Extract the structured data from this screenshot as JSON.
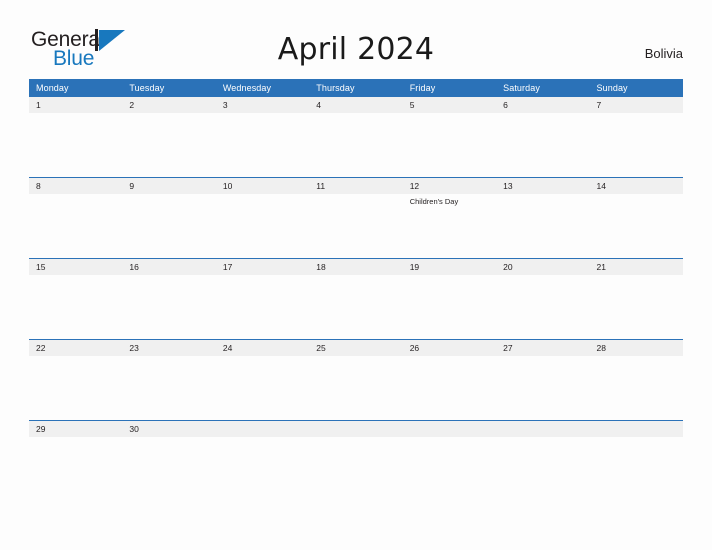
{
  "brand": {
    "name_part1": "General",
    "name_part2": "Blue",
    "mark": "triangle-flag-icon"
  },
  "header": {
    "title": "April 2024",
    "locale": "Bolivia"
  },
  "colors": {
    "header_blue": "#2b72b8",
    "brand_blue": "#1878be",
    "date_band_gray": "#f0f0f0",
    "page_background": "#fdfdfd",
    "text": "#231f20"
  },
  "calendar": {
    "day_names": [
      "Monday",
      "Tuesday",
      "Wednesday",
      "Thursday",
      "Friday",
      "Saturday",
      "Sunday"
    ],
    "weeks": [
      {
        "days": [
          {
            "date": "1",
            "events": []
          },
          {
            "date": "2",
            "events": []
          },
          {
            "date": "3",
            "events": []
          },
          {
            "date": "4",
            "events": []
          },
          {
            "date": "5",
            "events": []
          },
          {
            "date": "6",
            "events": []
          },
          {
            "date": "7",
            "events": []
          }
        ]
      },
      {
        "days": [
          {
            "date": "8",
            "events": []
          },
          {
            "date": "9",
            "events": []
          },
          {
            "date": "10",
            "events": []
          },
          {
            "date": "11",
            "events": []
          },
          {
            "date": "12",
            "events": [
              "Children's Day"
            ]
          },
          {
            "date": "13",
            "events": []
          },
          {
            "date": "14",
            "events": []
          }
        ]
      },
      {
        "days": [
          {
            "date": "15",
            "events": []
          },
          {
            "date": "16",
            "events": []
          },
          {
            "date": "17",
            "events": []
          },
          {
            "date": "18",
            "events": []
          },
          {
            "date": "19",
            "events": []
          },
          {
            "date": "20",
            "events": []
          },
          {
            "date": "21",
            "events": []
          }
        ]
      },
      {
        "days": [
          {
            "date": "22",
            "events": []
          },
          {
            "date": "23",
            "events": []
          },
          {
            "date": "24",
            "events": []
          },
          {
            "date": "25",
            "events": []
          },
          {
            "date": "26",
            "events": []
          },
          {
            "date": "27",
            "events": []
          },
          {
            "date": "28",
            "events": []
          }
        ]
      },
      {
        "days": [
          {
            "date": "29",
            "events": []
          },
          {
            "date": "30",
            "events": []
          },
          {
            "date": "",
            "events": []
          },
          {
            "date": "",
            "events": []
          },
          {
            "date": "",
            "events": []
          },
          {
            "date": "",
            "events": []
          },
          {
            "date": "",
            "events": []
          }
        ]
      }
    ]
  }
}
